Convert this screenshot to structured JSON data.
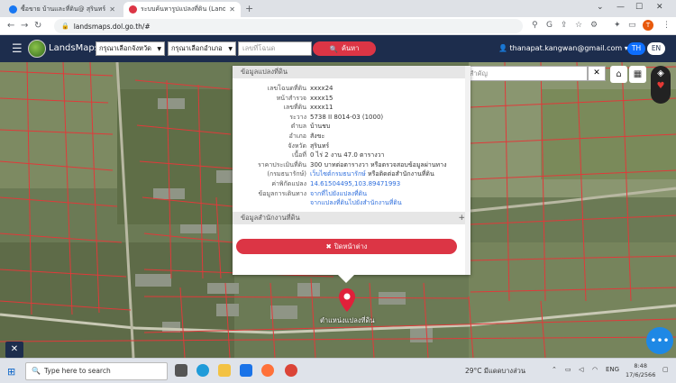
{
  "browser": {
    "tabs": [
      {
        "title": "ซื้อขาย บ้านและที่ดิน@ สุรินทร์ | Fa",
        "favicon_color": "#1877f2",
        "active": false
      },
      {
        "title": "ระบบค้นหารูปแปลงที่ดิน (LandsMaps)",
        "favicon_color": "#dc3545",
        "active": true
      }
    ],
    "new_tab": "+",
    "url": "landsmaps.dol.go.th/#",
    "profile_initial": "T"
  },
  "header": {
    "brand": "LandsMaps",
    "province_placeholder": "กรุณาเลือกจังหวัด",
    "district_placeholder": "กรุณาเลือกอำเภอ",
    "parcel_placeholder": "เลขที่โฉนด",
    "search_label": "ค้นหา",
    "user_email": "thanapat.kangwan@gmail.com",
    "lang_th": "TH",
    "lang_en": "EN"
  },
  "map": {
    "place_search_placeholder": "ค้นหาสถานที่สำคัญ",
    "pin_label": "ตำแหน่งแปลงที่ดิน"
  },
  "popup": {
    "section1_title": "ข้อมูลแปลงที่ดิน",
    "rows": [
      {
        "label": "เลขโฉนดที่ดิน",
        "value": "xxxx24"
      },
      {
        "label": "หน้าสำรวจ",
        "value": "xxxx15"
      },
      {
        "label": "เลขที่ดิน",
        "value": "xxxx11"
      },
      {
        "label": "ระวาง",
        "value": "5738 II 8014-03 (1000)"
      },
      {
        "label": "ตำบล",
        "value": "บ้านชบ"
      },
      {
        "label": "อำเภอ",
        "value": "สังขะ"
      },
      {
        "label": "จังหวัด",
        "value": "สุรินทร์"
      },
      {
        "label": "เนื้อที่",
        "value": "0 ไร่ 2 งาน 47.0 ตารางวา"
      },
      {
        "label": "ราคาประเมินที่ดิน",
        "value": "300 บาทต่อตารางวา หรือตรวจสอบข้อมูลผ่านทาง"
      },
      {
        "label": "(กรมธนารักษ์)",
        "value": "เว็บไซต์กรมธนารักษ์",
        "value_suffix": " หรือติดต่อสำนักงานที่ดิน"
      },
      {
        "label": "ค่าพิกัดแปลง",
        "value": "14.61504495,103.89471993"
      },
      {
        "label": "ข้อมูลการเดินทาง",
        "value": "จากที่ไปยังแปลงที่ดิน"
      },
      {
        "label": "",
        "value": "จากแปลงที่ดินไปยังสำนักงานที่ดิน"
      }
    ],
    "section2_title": "ข้อมูลสำนักงานที่ดิน",
    "close_label": "ปิดหน้าต่าง"
  },
  "taskbar": {
    "search_placeholder": "Type here to search",
    "weather": "29°C มีแดดบางส่วน",
    "lang": "ENG",
    "time": "8:48",
    "date": "17/6/2566"
  }
}
